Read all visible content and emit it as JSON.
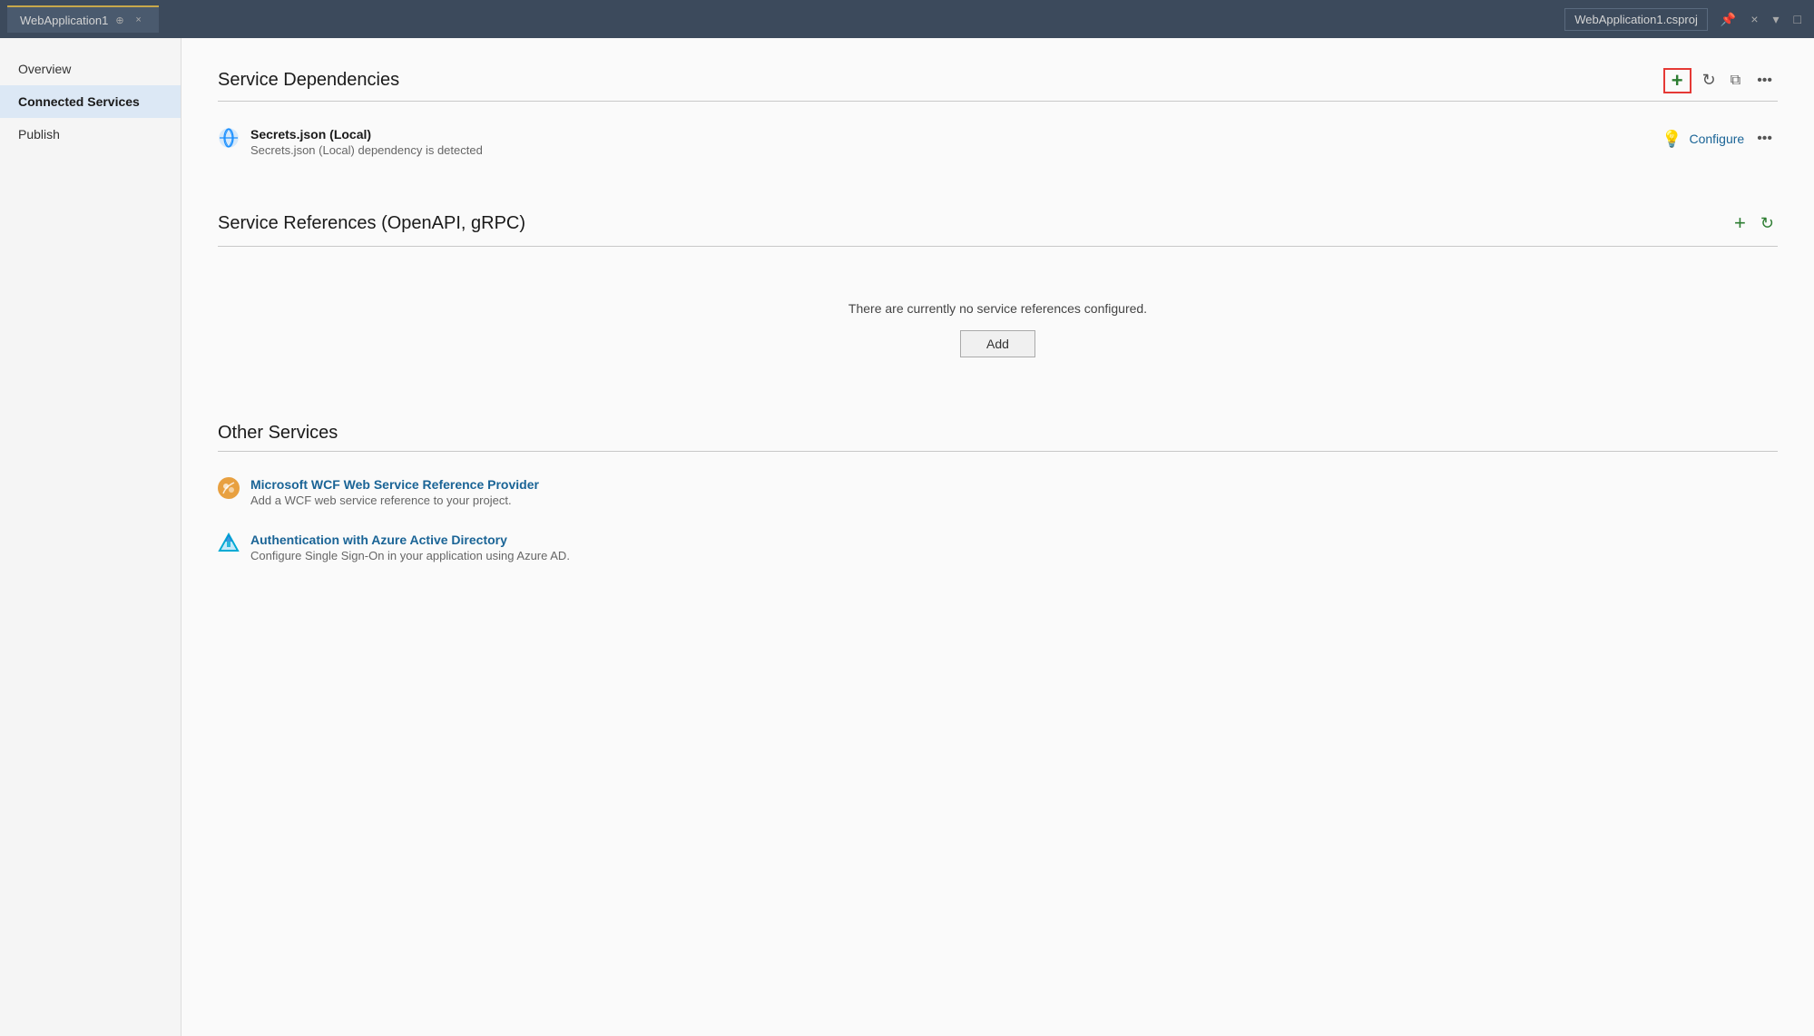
{
  "titlebar": {
    "tab_label": "WebApplication1",
    "tab_pin_icon": "📌",
    "tab_close_icon": "×",
    "project_name": "WebApplication1.csproj",
    "pin_icon": "📌",
    "close_icon": "×",
    "dropdown_icon": "▾",
    "maximize_icon": "□"
  },
  "sidebar": {
    "items": [
      {
        "label": "Overview",
        "id": "overview",
        "active": false
      },
      {
        "label": "Connected Services",
        "id": "connected-services",
        "active": true
      },
      {
        "label": "Publish",
        "id": "publish",
        "active": false
      }
    ]
  },
  "content": {
    "service_dependencies": {
      "title": "Service Dependencies",
      "add_tooltip": "+",
      "refresh_tooltip": "↻",
      "link_tooltip": "⧉",
      "more_tooltip": "•••",
      "items": [
        {
          "name": "Secrets.json (Local)",
          "description": "Secrets.json (Local) dependency is detected",
          "configure_label": "Configure",
          "icon_type": "secrets"
        }
      ]
    },
    "service_references": {
      "title": "Service References (OpenAPI, gRPC)",
      "empty_message": "There are currently no service references configured.",
      "add_button_label": "Add"
    },
    "other_services": {
      "title": "Other Services",
      "items": [
        {
          "name": "Microsoft WCF Web Service Reference Provider",
          "description": "Add a WCF web service reference to your project.",
          "icon_type": "wcf"
        },
        {
          "name": "Authentication with Azure Active Directory",
          "description": "Configure Single Sign-On in your application using Azure AD.",
          "icon_type": "azure"
        }
      ]
    }
  }
}
